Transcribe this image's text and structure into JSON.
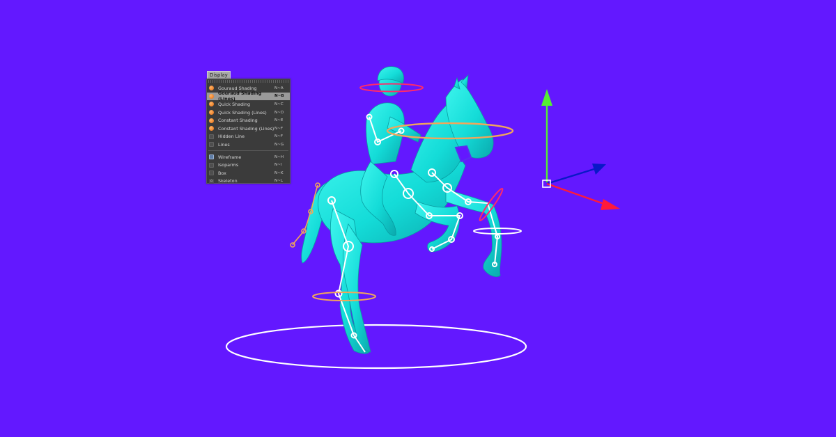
{
  "menu": {
    "tab_label": "Display",
    "items": [
      {
        "label": "Gouraud Shading",
        "shortcut": "N~A",
        "icon": "orange-sphere-icon",
        "selected": false
      },
      {
        "label": "Gouraud Shading (Lines)",
        "shortcut": "N~B",
        "icon": "orange-sphere-icon",
        "selected": true
      },
      {
        "label": "Quick Shading",
        "shortcut": "N~C",
        "icon": "orange-sphere-icon",
        "selected": false
      },
      {
        "label": "Quick Shading (Lines)",
        "shortcut": "N~D",
        "icon": "orange-sphere-icon",
        "selected": false
      },
      {
        "label": "Constant Shading",
        "shortcut": "N~E",
        "icon": "orange-sphere-icon",
        "selected": false
      },
      {
        "label": "Constant Shading (Lines)",
        "shortcut": "N~F",
        "icon": "orange-sphere-icon",
        "selected": false
      },
      {
        "label": "Hidden Line",
        "shortcut": "N~F",
        "icon": "hidden-line-icon",
        "selected": false
      },
      {
        "label": "Lines",
        "shortcut": "N~G",
        "icon": "lines-icon",
        "selected": false
      },
      {
        "label": "Wireframe",
        "shortcut": "N~H",
        "icon": "wireframe-icon",
        "selected": false
      },
      {
        "label": "Isoparms",
        "shortcut": "N~I",
        "icon": "isoparms-icon",
        "selected": false
      },
      {
        "label": "Box",
        "shortcut": "N~K",
        "icon": "box-icon",
        "selected": false
      },
      {
        "label": "Skeleton",
        "shortcut": "N~L",
        "icon": "skeleton-icon",
        "selected": false
      }
    ]
  },
  "colors": {
    "background": "#6318ff",
    "model": "#18e6e0",
    "model_shade": "#0cb3b4",
    "axis_y": "#55ee33",
    "axis_x": "#ff1a3a",
    "axis_z": "#0a18c8",
    "ring_white": "#ffffff",
    "ring_orange": "#f2a65a",
    "ring_red": "#ff2a6a"
  }
}
